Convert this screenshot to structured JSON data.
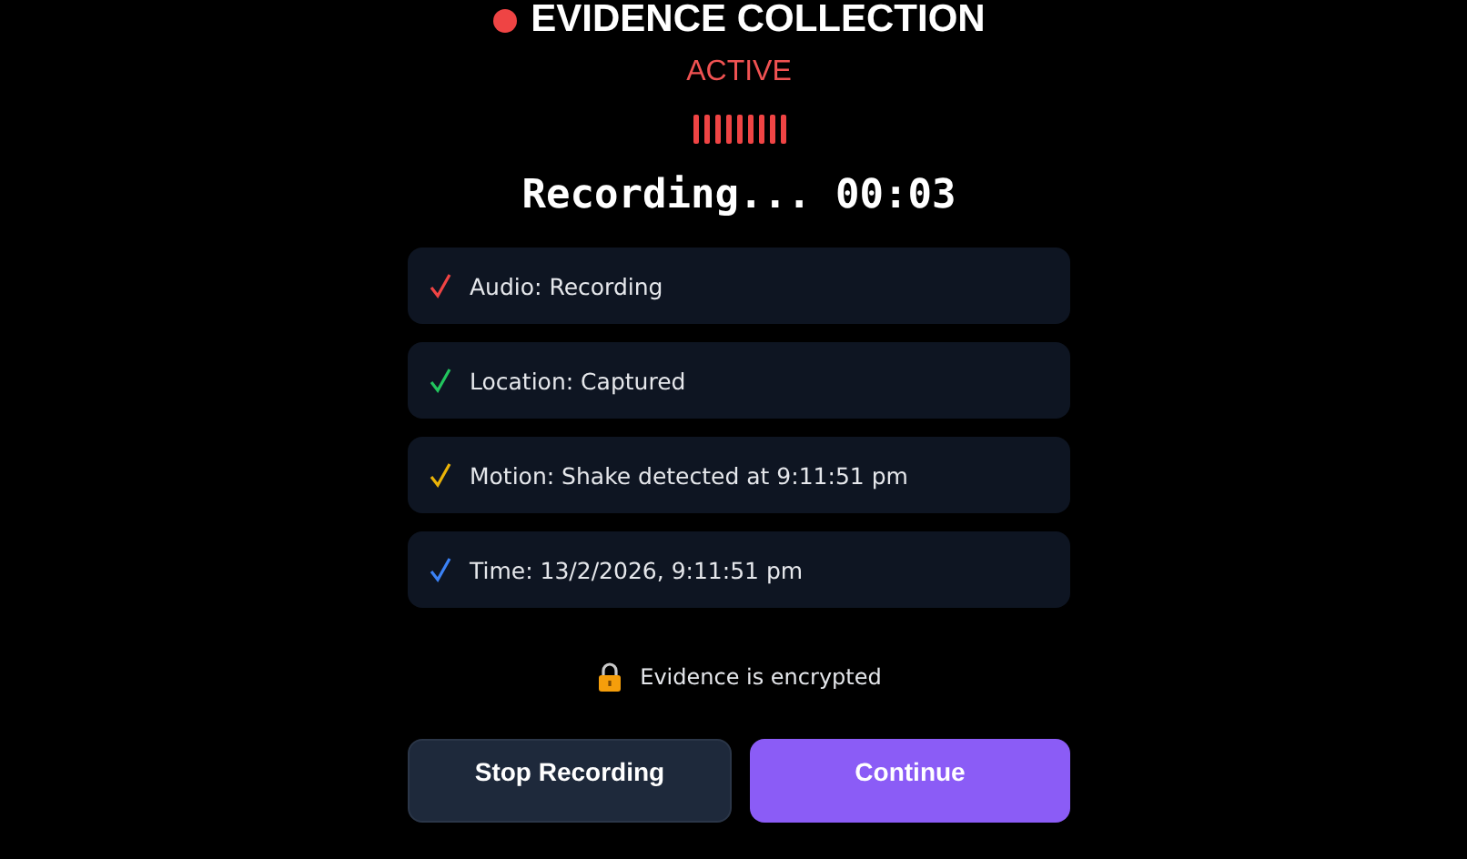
{
  "modal": {
    "title": "EVIDENCE COLLECTION",
    "status": "ACTIVE",
    "timer": "Recording... 00:03",
    "items": [
      {
        "text": "Audio: Recording",
        "color": "#ef4444"
      },
      {
        "text": "Location: Captured",
        "color": "#22c55e"
      },
      {
        "text": "Motion: Shake detected at 9:11:51 pm",
        "color": "#eab308"
      },
      {
        "text": "Time: 13/2/2026, 9:11:51 pm",
        "color": "#3b82f6"
      }
    ],
    "note": "Evidence is encrypted",
    "buttons": [
      {
        "label": "Stop Recording",
        "kind": "secondary"
      },
      {
        "label": "Continue",
        "kind": "primary"
      }
    ]
  }
}
